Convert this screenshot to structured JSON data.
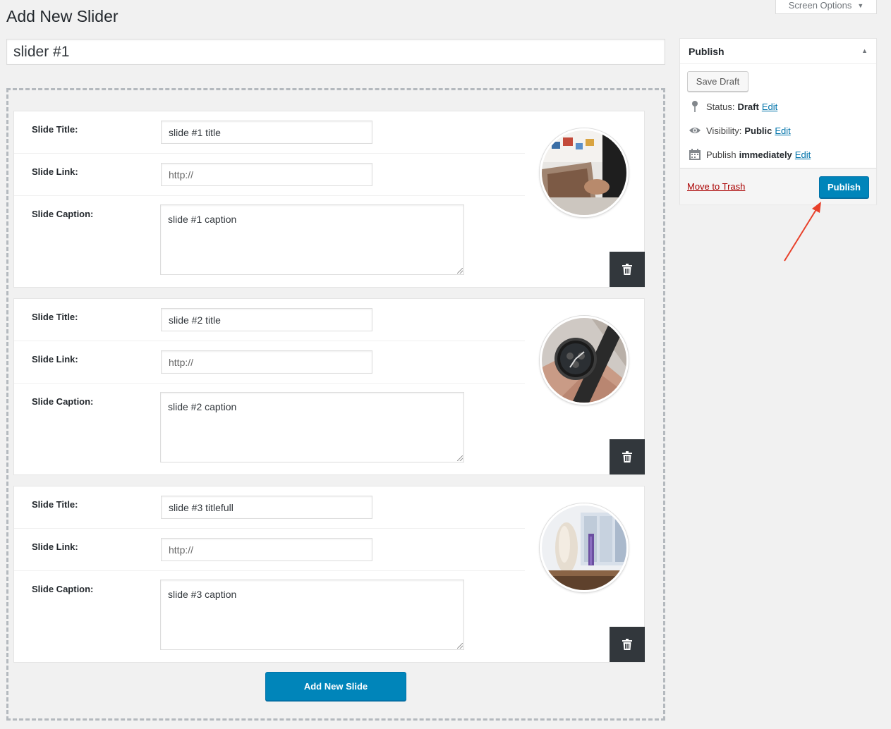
{
  "page": {
    "title": "Add New Slider"
  },
  "screen_options": {
    "label": "Screen Options"
  },
  "post_title": {
    "value": "slider #1"
  },
  "slides": [
    {
      "title_label": "Slide Title:",
      "title_value": "slide #1 title",
      "link_label": "Slide Link:",
      "link_value": "http://",
      "caption_label": "Slide Caption:",
      "caption_value": "slide #1 caption",
      "image": "desk-photos-image"
    },
    {
      "title_label": "Slide Title:",
      "title_value": "slide #2 title",
      "link_label": "Slide Link:",
      "link_value": "http://",
      "caption_label": "Slide Caption:",
      "caption_value": "slide #2 caption",
      "image": "wristwatch-image"
    },
    {
      "title_label": "Slide Title:",
      "title_value": "slide #3 titlefull",
      "link_label": "Slide Link:",
      "link_value": "http://",
      "caption_label": "Slide Caption:",
      "caption_value": "slide #3 caption",
      "image": "vase-window-image"
    }
  ],
  "add_slide": {
    "label": "Add New Slide"
  },
  "publish_box": {
    "heading": "Publish",
    "save_draft": "Save Draft",
    "status_label": "Status:",
    "status_value": "Draft",
    "visibility_label": "Visibility:",
    "visibility_value": "Public",
    "schedule_label": "Publish",
    "schedule_value": "immediately",
    "edit": "Edit",
    "trash": "Move to Trash",
    "publish": "Publish"
  },
  "colors": {
    "primary_button": "#0085ba",
    "trash_link": "#a00",
    "link": "#0073aa",
    "annotation_arrow": "#e8402a"
  }
}
